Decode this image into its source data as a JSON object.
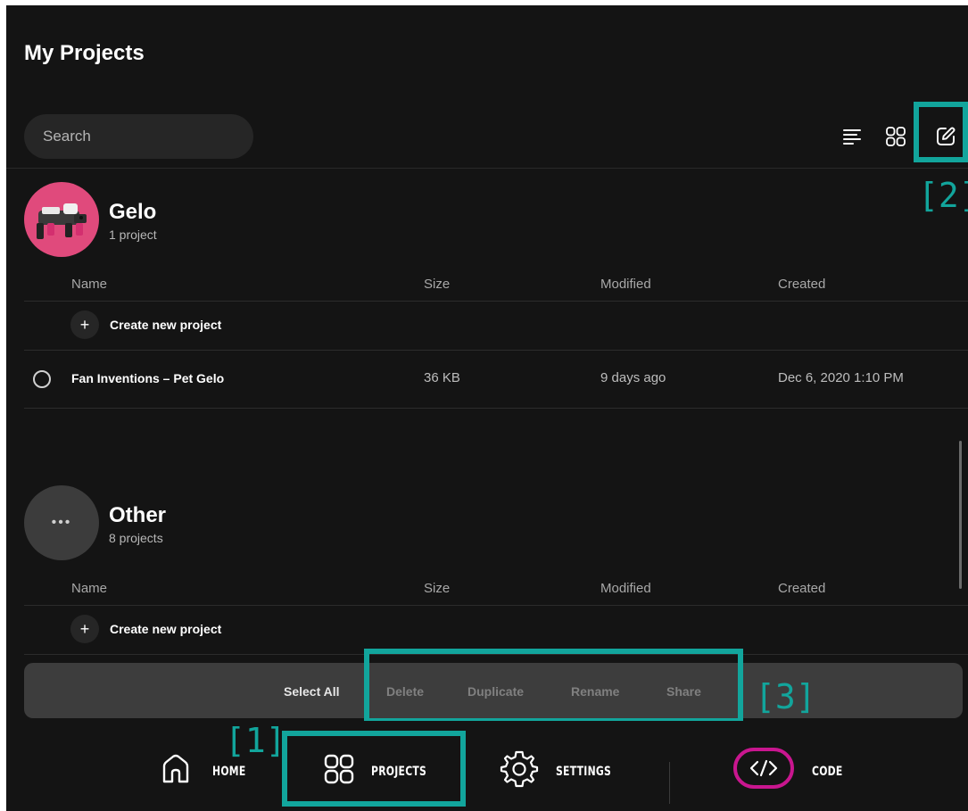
{
  "header": {
    "title": "My Projects",
    "search_placeholder": "Search"
  },
  "toolbar": {
    "icons": [
      "sort-lines-icon",
      "grid-view-icon",
      "edit-icon"
    ]
  },
  "columns": {
    "name": "Name",
    "size": "Size",
    "modified": "Modified",
    "created": "Created"
  },
  "groups": [
    {
      "name": "Gelo",
      "count": "1 project",
      "create_label": "Create new project",
      "projects": [
        {
          "name": "Fan Inventions – Pet Gelo",
          "size": "36 KB",
          "modified": "9 days ago",
          "created": "Dec 6, 2020 1:10 PM"
        }
      ]
    },
    {
      "name": "Other",
      "count": "8 projects",
      "create_label": "Create new project",
      "avatar_glyph": "•••"
    }
  ],
  "action_bar": {
    "select_all": "Select All",
    "delete": "Delete",
    "duplicate": "Duplicate",
    "rename": "Rename",
    "share": "Share"
  },
  "nav": {
    "home": "HOME",
    "projects": "PROJECTS",
    "settings": "SETTINGS",
    "code": "CODE"
  },
  "annotations": {
    "label_1": "[1]",
    "label_2": "[2]",
    "label_3": "[3]"
  },
  "colors": {
    "background": "#141414",
    "highlight": "#12a59c",
    "code_ring": "#c9168f",
    "gelo_avatar": "#e04a7c"
  }
}
